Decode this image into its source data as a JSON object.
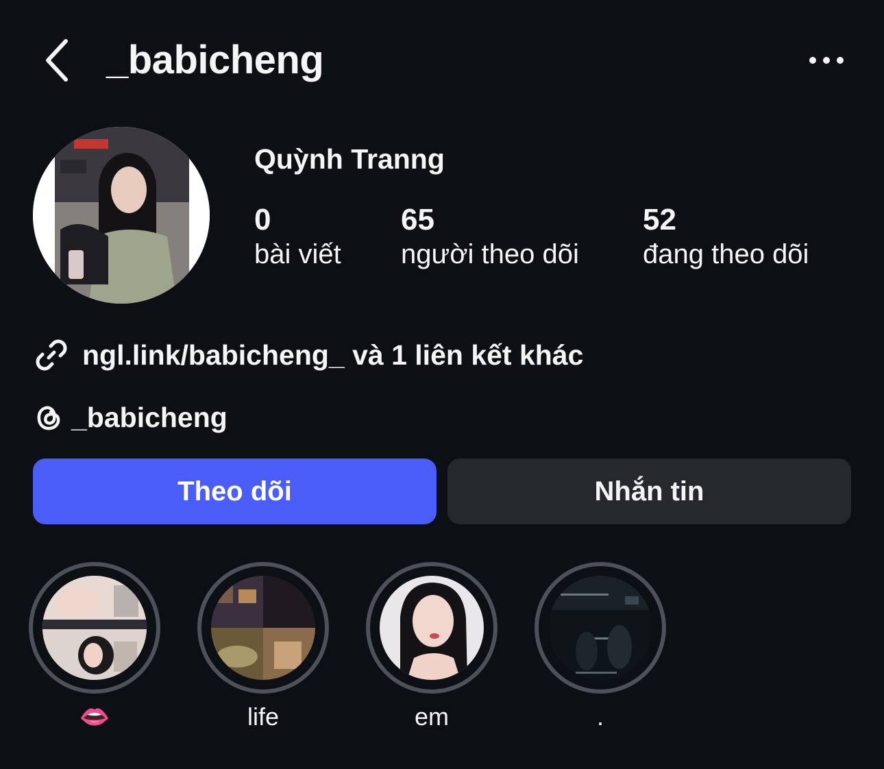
{
  "header": {
    "username": "_babicheng",
    "back_icon": "chevron-left-icon",
    "more_icon": "more-horizontal-icon"
  },
  "profile": {
    "full_name": "Quỳnh Tranng",
    "stats": [
      {
        "value": "0",
        "label": "bài viết"
      },
      {
        "value": "65",
        "label": "người theo dõi"
      },
      {
        "value": "52",
        "label": "đang theo dõi"
      }
    ],
    "link_text": "ngl.link/babicheng_ và 1 liên kết khác",
    "threads_handle": "_babicheng"
  },
  "actions": {
    "follow_label": "Theo dõi",
    "message_label": "Nhắn tin"
  },
  "highlights": [
    {
      "label": "👄"
    },
    {
      "label": "life"
    },
    {
      "label": "em"
    },
    {
      "label": "."
    }
  ],
  "colors": {
    "background": "#0c1014",
    "follow_button": "#4a5df9",
    "message_button": "#25292e",
    "highlight_ring": "#4b525b"
  }
}
